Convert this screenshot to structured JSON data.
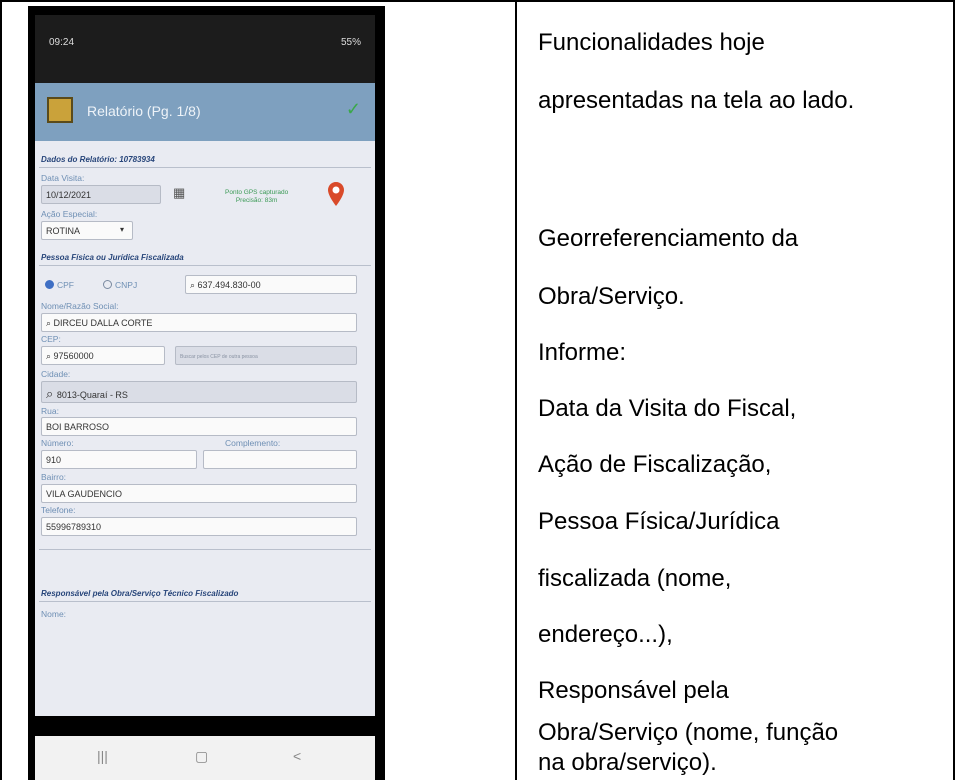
{
  "phone_screen": {
    "status_time": "09:24",
    "status_right": "55%",
    "app_title": "Relatório (Pg. 1/8)",
    "report_section": "Dados do Relatório: 10783934",
    "visit_date_label": "Data Visita:",
    "visit_date_value": "10/12/2021",
    "gps_text_line1": "Ponto GPS capturado",
    "gps_text_line2": "Precisão: 83m",
    "action_label": "Ação Especial:",
    "action_value": "ROTINA",
    "person_section": "Pessoa Física ou Jurídica Fiscalizada",
    "radio_cpf": "CPF",
    "radio_cnpj": "CNPJ",
    "document_value": "637.494.830-00",
    "name_label": "Nome/Razão Social:",
    "name_value": "DIRCEU DALLA CORTE",
    "cep_label": "CEP:",
    "cep_value": "97560000",
    "cep_hint": "Buscar pelos CEP de outra pessoa",
    "city_label": "Cidade:",
    "city_value": "8013-Quaraí - RS",
    "street_label": "Rua:",
    "street_value": "BOI BARROSO",
    "number_label": "Número:",
    "number_value": "910",
    "complement_label": "Complemento:",
    "complement_value": "",
    "district_label": "Bairro:",
    "district_value": "VILA GAUDENCIO",
    "phone_label": "Telefone:",
    "phone_value": "55996789310",
    "responsible_section": "Responsável pela Obra/Serviço Técnico Fiscalizado",
    "responsible_name_label": "Nome:",
    "nav_recent": "|||",
    "nav_home": "▢",
    "nav_back": "<"
  },
  "description": {
    "lines": [
      "Funcionalidades hoje",
      "apresentadas na tela ao lado.",
      "Georreferenciamento da",
      "Obra/Serviço.",
      "Informe:",
      "Data da Visita do Fiscal,",
      "Ação de Fiscalização,",
      "Pessoa Física/Jurídica",
      "fiscalizada (nome,",
      "endereço...),",
      "Responsável pela",
      "Obra/Serviço (nome, função",
      "na obra/serviço)."
    ]
  },
  "colors": {
    "app_bar": "#7ea0bf",
    "section_title": "#27457a",
    "gps_ok": "#3b9a56",
    "pin": "#d94a2a"
  }
}
